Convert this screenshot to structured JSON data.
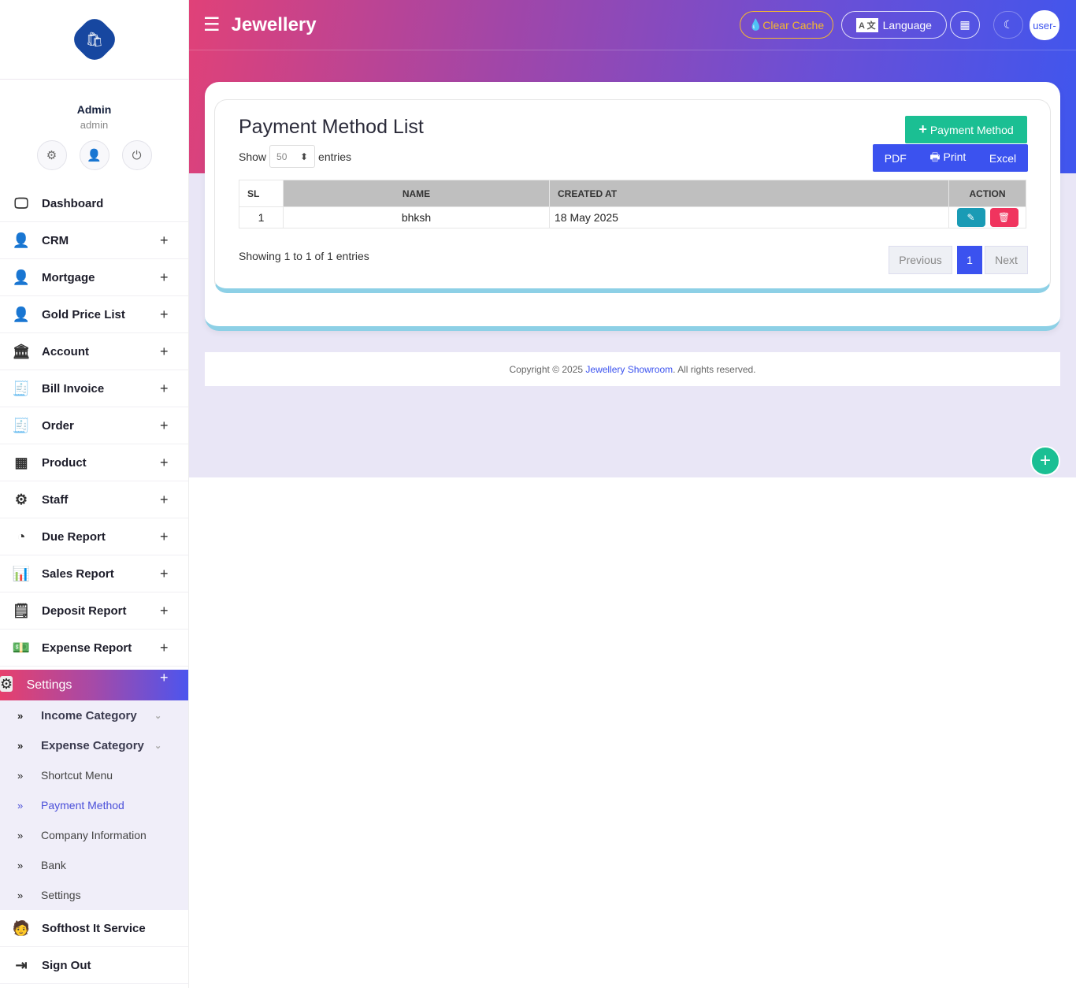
{
  "app": {
    "title": "Jewellery"
  },
  "user": {
    "name": "Admin",
    "role": "admin",
    "avatar_alt": "user-"
  },
  "header": {
    "clear_cache": "Clear Cache",
    "language": "Language"
  },
  "menu": [
    {
      "label": "Dashboard",
      "icon": "monitor-icon",
      "glyph": "🖵",
      "plus": false
    },
    {
      "label": "CRM",
      "icon": "user-plus-icon",
      "glyph": "👤",
      "plus": true
    },
    {
      "label": "Mortgage",
      "icon": "user-plus-icon",
      "glyph": "👤",
      "plus": true
    },
    {
      "label": "Gold Price List",
      "icon": "user-plus-icon",
      "glyph": "👤",
      "plus": true
    },
    {
      "label": "Account",
      "icon": "bank-icon",
      "glyph": "🏛",
      "plus": true
    },
    {
      "label": "Bill Invoice",
      "icon": "invoice-icon",
      "glyph": "🧾",
      "plus": true
    },
    {
      "label": "Order",
      "icon": "invoice-icon",
      "glyph": "🧾",
      "plus": true
    },
    {
      "label": "Product",
      "icon": "boxes-icon",
      "glyph": "▦",
      "plus": true
    },
    {
      "label": "Staff",
      "icon": "staff-icon",
      "glyph": "⚙",
      "plus": true
    },
    {
      "label": "Due Report",
      "icon": "pie-chart-icon",
      "glyph": "◔",
      "plus": true
    },
    {
      "label": "Sales Report",
      "icon": "bar-chart-icon",
      "glyph": "📊",
      "plus": true
    },
    {
      "label": "Deposit Report",
      "icon": "receipt-icon",
      "glyph": "🗒",
      "plus": true
    },
    {
      "label": "Expense Report",
      "icon": "money-icon",
      "glyph": "💵",
      "plus": true
    }
  ],
  "settings": {
    "label": "Settings",
    "sub": [
      {
        "label": "Income Category",
        "bold": true,
        "dropdown": true
      },
      {
        "label": "Expense Category",
        "bold": true,
        "dropdown": true
      },
      {
        "label": "Shortcut Menu"
      },
      {
        "label": "Payment Method",
        "active": true
      },
      {
        "label": "Company Information"
      },
      {
        "label": "Bank"
      },
      {
        "label": "Settings"
      }
    ]
  },
  "bottom_menu": [
    {
      "label": "Softhost It Service"
    },
    {
      "label": "Sign Out"
    }
  ],
  "page": {
    "title": "Payment Method List",
    "add_button": "Payment Method",
    "show": "Show",
    "entries": "entries",
    "page_size": "50",
    "export": {
      "pdf": "PDF",
      "print": "Print",
      "excel": "Excel"
    },
    "columns": [
      "SL",
      "NAME",
      "CREATED AT",
      "ACTION"
    ],
    "rows": [
      {
        "sl": "1",
        "name": "bhksh",
        "created_at": "18 May 2025"
      }
    ],
    "info": "Showing 1 to 1 of 1 entries",
    "pagination": {
      "previous": "Previous",
      "current": "1",
      "next": "Next"
    }
  },
  "footer": {
    "prefix": "Copyright © 2025 ",
    "link": "Jewellery Showroom",
    "suffix": ". All rights reserved."
  }
}
